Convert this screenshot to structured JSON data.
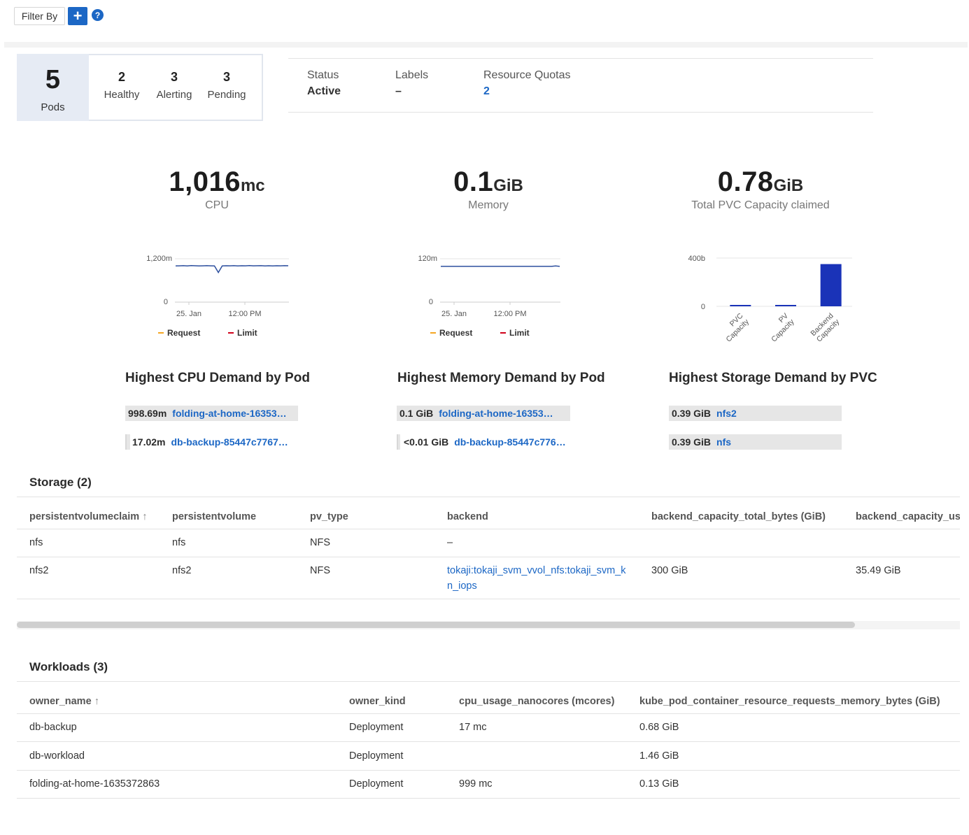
{
  "filter": {
    "label": "Filter By",
    "add_icon": "+",
    "help_icon": "?"
  },
  "pods": {
    "count": "5",
    "label": "Pods",
    "stats": [
      {
        "n": "2",
        "label": "Healthy"
      },
      {
        "n": "3",
        "label": "Alerting"
      },
      {
        "n": "3",
        "label": "Pending"
      }
    ]
  },
  "status_panel": {
    "status_label": "Status",
    "status_value": "Active",
    "labels_label": "Labels",
    "labels_value": "–",
    "quotas_label": "Resource Quotas",
    "quotas_value": "2"
  },
  "kpis": {
    "cpu": {
      "value": "1,016",
      "unit": "mc",
      "label": "CPU"
    },
    "memory": {
      "value": "0.1",
      "unit": "GiB",
      "label": "Memory"
    },
    "pvc": {
      "value": "0.78",
      "unit": "GiB",
      "label": "Total PVC Capacity claimed"
    }
  },
  "chart_data": [
    {
      "type": "line",
      "x_ticks": [
        "25. Jan",
        "12:00 PM"
      ],
      "y_ticks": [
        "0",
        "1,200m"
      ],
      "ylim": [
        0,
        1200
      ],
      "series": [
        {
          "name": "Request",
          "color": "#f5a623",
          "values": []
        },
        {
          "name": "Limit",
          "color": "#d0021b",
          "values": []
        },
        {
          "name": "",
          "color": "#2d4f9e",
          "values": [
            1000,
            1005,
            1008,
            1003,
            1010,
            1006,
            1002,
            1004,
            1009,
            1005,
            1003,
            820,
            1002,
            1006,
            1004,
            1008,
            1003,
            1007,
            1005,
            1010,
            1004,
            1006,
            1008,
            1002,
            1006,
            1003,
            1007,
            1005,
            1008,
            1006
          ]
        }
      ]
    },
    {
      "type": "line",
      "x_ticks": [
        "25. Jan",
        "12:00 PM"
      ],
      "y_ticks": [
        "0",
        "120m"
      ],
      "ylim": [
        0,
        120
      ],
      "series": [
        {
          "name": "Request",
          "color": "#f5a623",
          "values": []
        },
        {
          "name": "Limit",
          "color": "#d0021b",
          "values": []
        },
        {
          "name": "",
          "color": "#2d4f9e",
          "values": [
            99,
            99,
            99,
            99,
            99,
            99,
            99,
            99,
            99,
            99,
            99,
            99,
            99,
            99,
            99,
            99,
            99,
            99,
            99,
            99,
            99,
            99,
            99,
            99,
            99,
            99,
            99,
            99,
            100,
            99
          ]
        }
      ]
    },
    {
      "type": "bar",
      "categories": [
        "PVC Capacity",
        "PV Capacity",
        "Backend Capacity"
      ],
      "values": [
        4,
        4,
        350
      ],
      "y_ticks": [
        "0",
        "400b"
      ],
      "ylim": [
        0,
        400
      ],
      "color": "#1a33b8"
    }
  ],
  "demand": {
    "cpu": {
      "title": "Highest CPU Demand by Pod",
      "rows": [
        {
          "value": "998.69m",
          "name": "folding-at-home-16353…",
          "fill": 1.0
        },
        {
          "value": "17.02m",
          "name": "db-backup-85447c7767…",
          "fill": 0.02
        }
      ]
    },
    "memory": {
      "title": "Highest Memory Demand by Pod",
      "rows": [
        {
          "value": "0.1 GiB",
          "name": "folding-at-home-16353…",
          "fill": 1.0
        },
        {
          "value": "<0.01 GiB",
          "name": "db-backup-85447c776…",
          "fill": 0.01
        }
      ]
    },
    "storage": {
      "title": "Highest Storage Demand by PVC",
      "rows": [
        {
          "value": "0.39 GiB",
          "name": "nfs2",
          "fill": 1.0
        },
        {
          "value": "0.39 GiB",
          "name": "nfs",
          "fill": 1.0
        }
      ]
    }
  },
  "storage_table": {
    "title": "Storage (2)",
    "columns": [
      "persistentvolumeclaim",
      "persistentvolume",
      "pv_type",
      "backend",
      "backend_capacity_total_bytes (GiB)",
      "backend_capacity_us"
    ],
    "sort_icon": "↑",
    "rows": [
      [
        "nfs",
        "nfs",
        "NFS",
        "–",
        "",
        ""
      ],
      [
        "nfs2",
        "nfs2",
        "NFS",
        "tokaji:tokaji_svm_vvol_nfs:tokaji_svm_k",
        "300 GiB",
        "35.49 GiB"
      ]
    ],
    "backend_wrap": "n_iops"
  },
  "workloads_table": {
    "title": "Workloads (3)",
    "columns": [
      "owner_name",
      "owner_kind",
      "cpu_usage_nanocores (mcores)",
      "kube_pod_container_resource_requests_memory_bytes (GiB)"
    ],
    "sort_icon": "↑",
    "rows": [
      [
        "db-backup",
        "Deployment",
        "17 mc",
        "0.68 GiB"
      ],
      [
        "db-workload",
        "Deployment",
        "",
        "1.46 GiB"
      ],
      [
        "folding-at-home-1635372863",
        "Deployment",
        "999 mc",
        "0.13 GiB"
      ]
    ]
  }
}
